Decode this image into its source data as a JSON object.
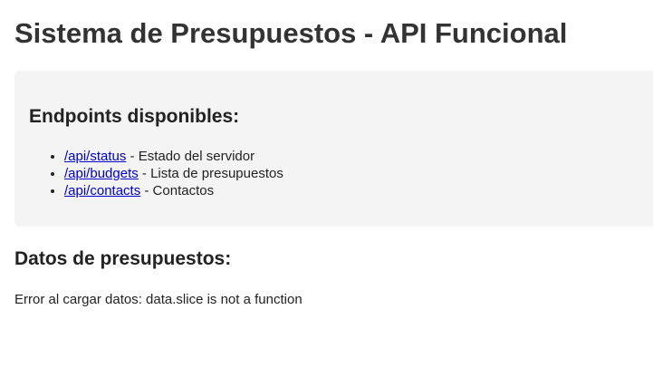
{
  "page": {
    "title": "Sistema de Presupuestos - API Funcional"
  },
  "endpoints": {
    "heading": "Endpoints disponibles:",
    "items": [
      {
        "link": "/api/status",
        "description": " - Estado del servidor"
      },
      {
        "link": "/api/budgets",
        "description": " - Lista de presupuestos"
      },
      {
        "link": "/api/contacts",
        "description": " - Contactos"
      }
    ]
  },
  "budgets": {
    "heading": "Datos de presupuestos:",
    "error": "Error al cargar datos: data.slice is not a function"
  },
  "colors": {
    "panel_background": "#f4f4f4",
    "link": "#0000cc",
    "title_text": "#333333"
  }
}
